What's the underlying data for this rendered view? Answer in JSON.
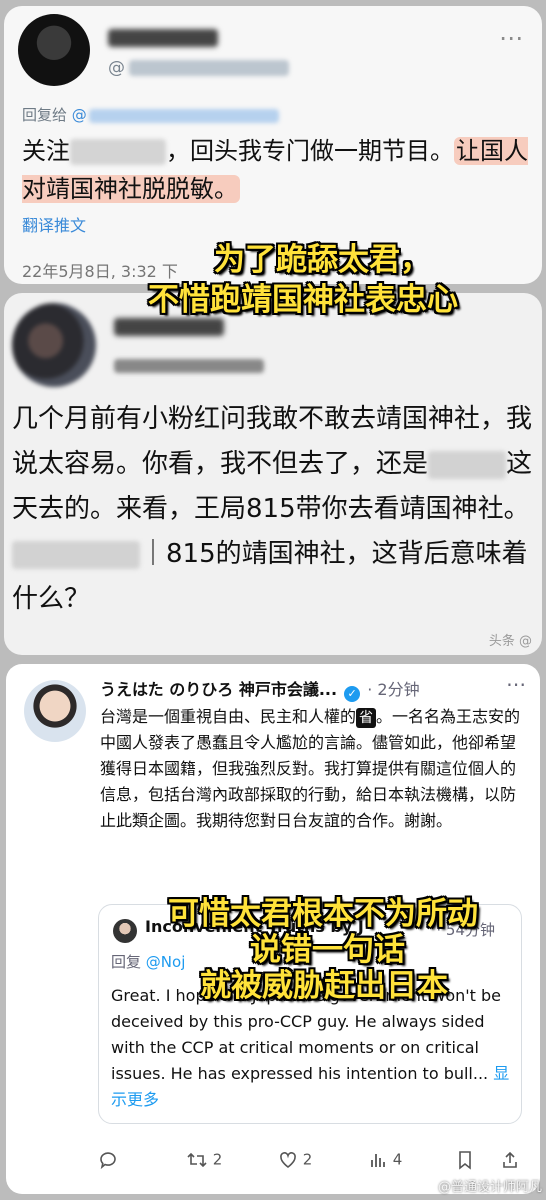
{
  "panel1": {
    "handle_prefix": "@",
    "reply_label": "回复给",
    "reply_at": "@",
    "text_a": "关注",
    "text_b": "，回头我专门做一期节目。",
    "text_highlight": "让国人对靖国神社脱脱敏。",
    "translate": "翻译推文",
    "time": "22年5月8日, 3:32 下"
  },
  "caption1": {
    "line1": "为了跪舔太君，",
    "line2": "不惜跑靖国神社表忠心"
  },
  "panel2": {
    "text_a": "几个月前有小粉红问我敢不敢去靖国神社，我说太容易。你看，我不但去了，还是",
    "text_b": "这天去的。来看，王局815带你去看靖国神社。",
    "text_c": "｜815的靖国神社，这背后意味着什么？",
    "watermark": "头条 @"
  },
  "panel3": {
    "author": "うえはた のりひろ 神戸市会議...",
    "time": "· 2分钟",
    "text": "台灣是一個重視自由、民主和人權的",
    "stamp": "省",
    "text_rest": "。一名名為王志安的中國人發表了愚蠢且令人尷尬的言論。儘管如此，他卻希望獲得日本國籍，但我強烈反對。我打算提供有關這位個人的信息，包括台灣內政部採取的行動，給日本執法機構，以防止此類企圖。我期待您對日台友誼的合作。謝謝。",
    "quote": {
      "name": "Inconvenient Truths by J",
      "time": "· 54分钟",
      "reply_label": "回复",
      "reply_at": "@Noj",
      "text": "Great. I hope the Japanese government won't be deceived by this pro-CCP guy. He always sided with the CCP at critical moments or on critical issues. He has expressed his intention to bull...",
      "show_more": "显示更多"
    },
    "actions": {
      "retweets": "2",
      "likes": "2",
      "views": "4"
    }
  },
  "caption2": {
    "line1": "可惜太君根本不为所动",
    "line2": "说错一句话",
    "line3": "就被威胁赶出日本"
  },
  "watermark": "@普通设计师阿凡"
}
